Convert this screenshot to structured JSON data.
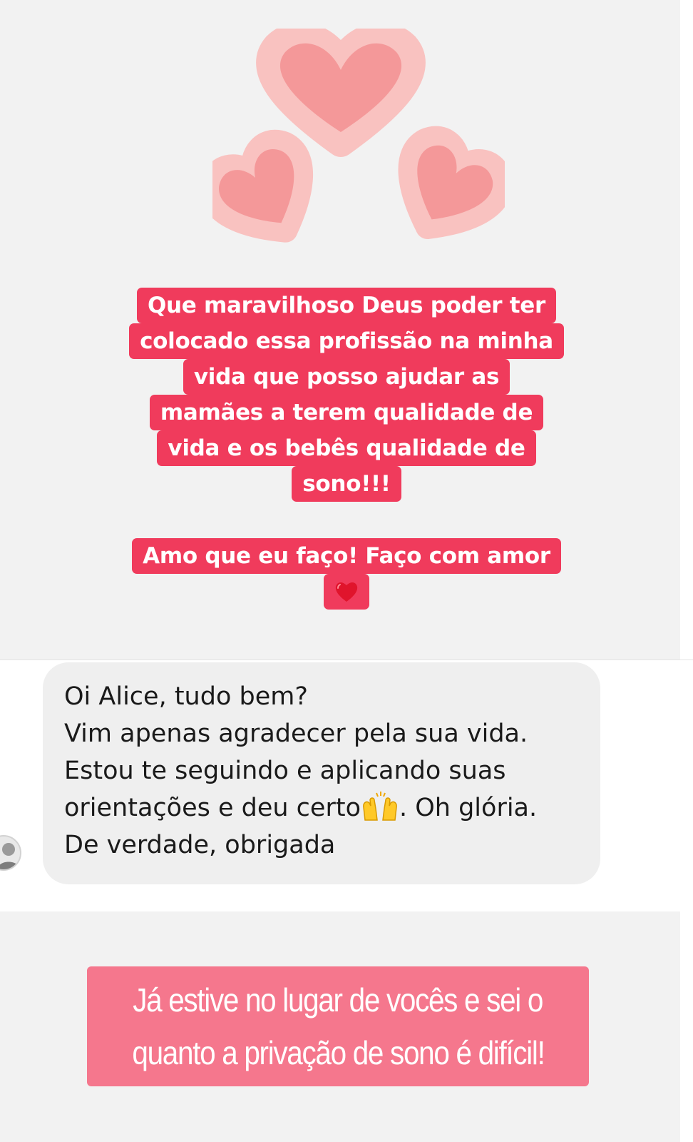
{
  "sticker": {
    "icon": "three-hearts-sticker",
    "colors": {
      "outer": "#f9c2c0",
      "inner": "#f49899"
    }
  },
  "caption_1": {
    "lines": [
      "Que maravilhoso Deus poder ter",
      "colocado essa profissão na minha",
      "vida que posso  ajudar as",
      "mamães a terem qualidade de",
      "vida e os bebês qualidade de",
      "sono!!!"
    ],
    "background": "#f03b5c"
  },
  "caption_2": {
    "line_1": "Amo que eu faço! Faço com amor",
    "emoji": "red-heart-icon"
  },
  "message": {
    "avatar_icon": "user-avatar-icon",
    "lines": [
      "Oi Alice, tudo bem?",
      "Vim apenas agradecer pela sua vida.",
      "Estou te seguindo e aplicando suas",
      "De verdade, obrigada"
    ],
    "line_4_before": "orientações e deu certo",
    "line_4_emoji": "raising-hands-icon",
    "line_4_after": ". Oh glória."
  },
  "bottom_caption": {
    "lines": [
      "Já estive no lugar de vocês e sei o",
      "quanto a privação de sono é difícil!"
    ],
    "background": "#f5778d"
  }
}
